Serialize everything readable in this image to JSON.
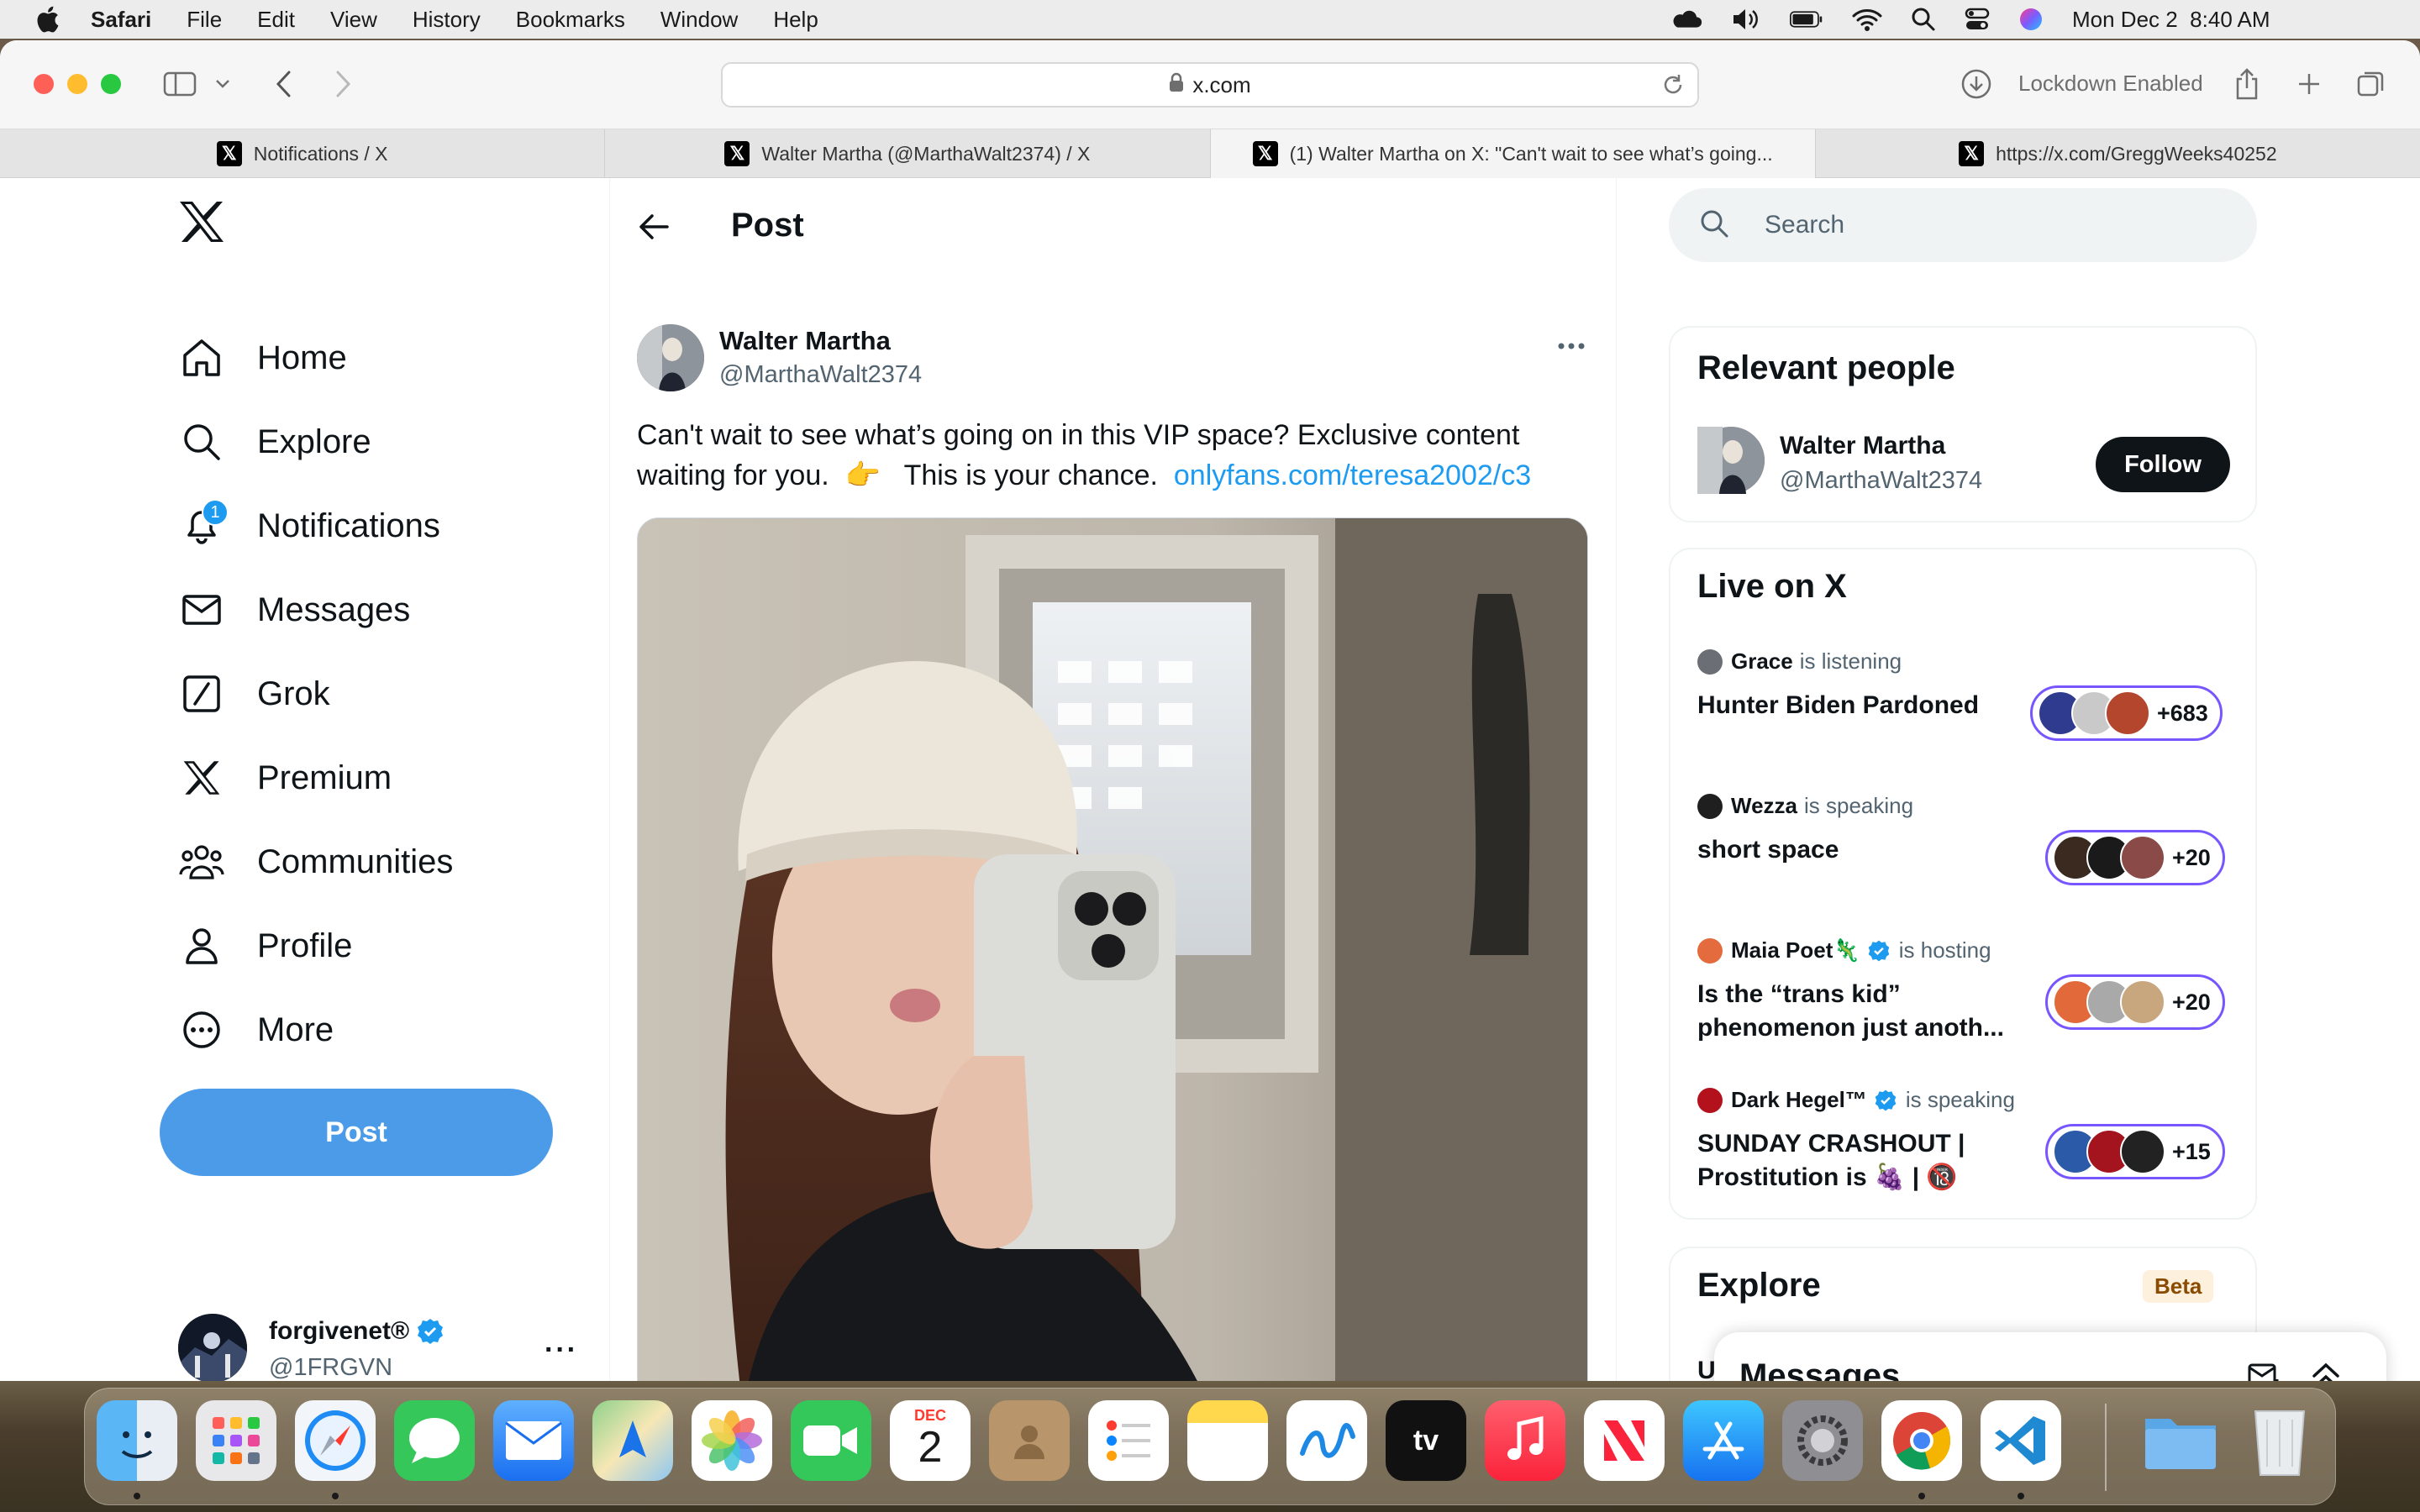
{
  "menubar": {
    "app": "Safari",
    "items": [
      "File",
      "Edit",
      "View",
      "History",
      "Bookmarks",
      "Window",
      "Help"
    ],
    "datetime": "Mon Dec 2  8:40 AM"
  },
  "browser": {
    "url": "x.com",
    "lockdown": "Lockdown Enabled",
    "tabs": [
      {
        "title": "Notifications / X"
      },
      {
        "title": "Walter Martha (@MarthaWalt2374) / X"
      },
      {
        "title": "(1) Walter Martha on X: \"Can't wait to see what’s going..."
      },
      {
        "title": "https://x.com/GreggWeeks40252"
      }
    ]
  },
  "nav": {
    "items": [
      {
        "label": "Home",
        "icon": "home-icon"
      },
      {
        "label": "Explore",
        "icon": "search-icon"
      },
      {
        "label": "Notifications",
        "icon": "bell-icon",
        "badge": "1"
      },
      {
        "label": "Messages",
        "icon": "mail-icon"
      },
      {
        "label": "Grok",
        "icon": "grok-icon"
      },
      {
        "label": "Premium",
        "icon": "x-logo-icon"
      },
      {
        "label": "Communities",
        "icon": "people-icon"
      },
      {
        "label": "Profile",
        "icon": "person-icon"
      },
      {
        "label": "More",
        "icon": "more-circle-icon"
      }
    ],
    "post_button": "Post",
    "account": {
      "name": "forgivenet®",
      "handle": "@1FRGVN"
    }
  },
  "post": {
    "header": "Post",
    "author_name": "Walter Martha",
    "author_handle": "@MarthaWalt2374",
    "text_line1": "Can't wait to see what’s going on in this VIP space?  Exclusive content",
    "text_line2_a": "waiting for you.  👉   This is your chance.  ",
    "link": "onlyfans.com/teresa2002/c3"
  },
  "sidebar": {
    "search_placeholder": "Search",
    "relevant_title": "Relevant people",
    "relevant_person": {
      "name": "Walter Martha",
      "handle": "@MarthaWalt2374",
      "button": "Follow"
    },
    "live_title": "Live on X",
    "spaces": [
      {
        "host": "Grace",
        "status": "is listening",
        "title": "Hunter Biden Pardoned",
        "count": "+683",
        "verified": false
      },
      {
        "host": "Wezza",
        "status": "is speaking",
        "title": "short space",
        "count": "+20",
        "verified": false
      },
      {
        "host": "Maia Poet🦎",
        "status": "is hosting",
        "title": "Is the “trans kid” phenomenon just anoth...",
        "count": "+20",
        "verified": true
      },
      {
        "host": "Dark Hegel™",
        "status": "is speaking",
        "title": "SUNDAY CRASHOUT | Prostitution is 🍇 | 🔞",
        "count": "+15",
        "verified": true
      }
    ],
    "explore_title": "Explore",
    "explore_badge": "Beta",
    "explore_peek": "U\nL"
  },
  "messages_drawer": {
    "title": "Messages"
  },
  "dock": {
    "apps": [
      "Finder",
      "Launchpad",
      "Safari",
      "Messages",
      "Mail",
      "Maps",
      "Photos",
      "FaceTime",
      "Calendar",
      "Contacts",
      "Reminders",
      "Notes",
      "Freeform",
      "TV",
      "Music",
      "News",
      "App Store",
      "System Settings",
      "Chrome",
      "VS Code",
      "Downloads",
      "Trash"
    ],
    "calendar_month": "DEC",
    "calendar_day": "2"
  },
  "colors": {
    "accent": "#1d9bf0",
    "post_button": "#4b9be8",
    "space_border": "#7856ff"
  }
}
